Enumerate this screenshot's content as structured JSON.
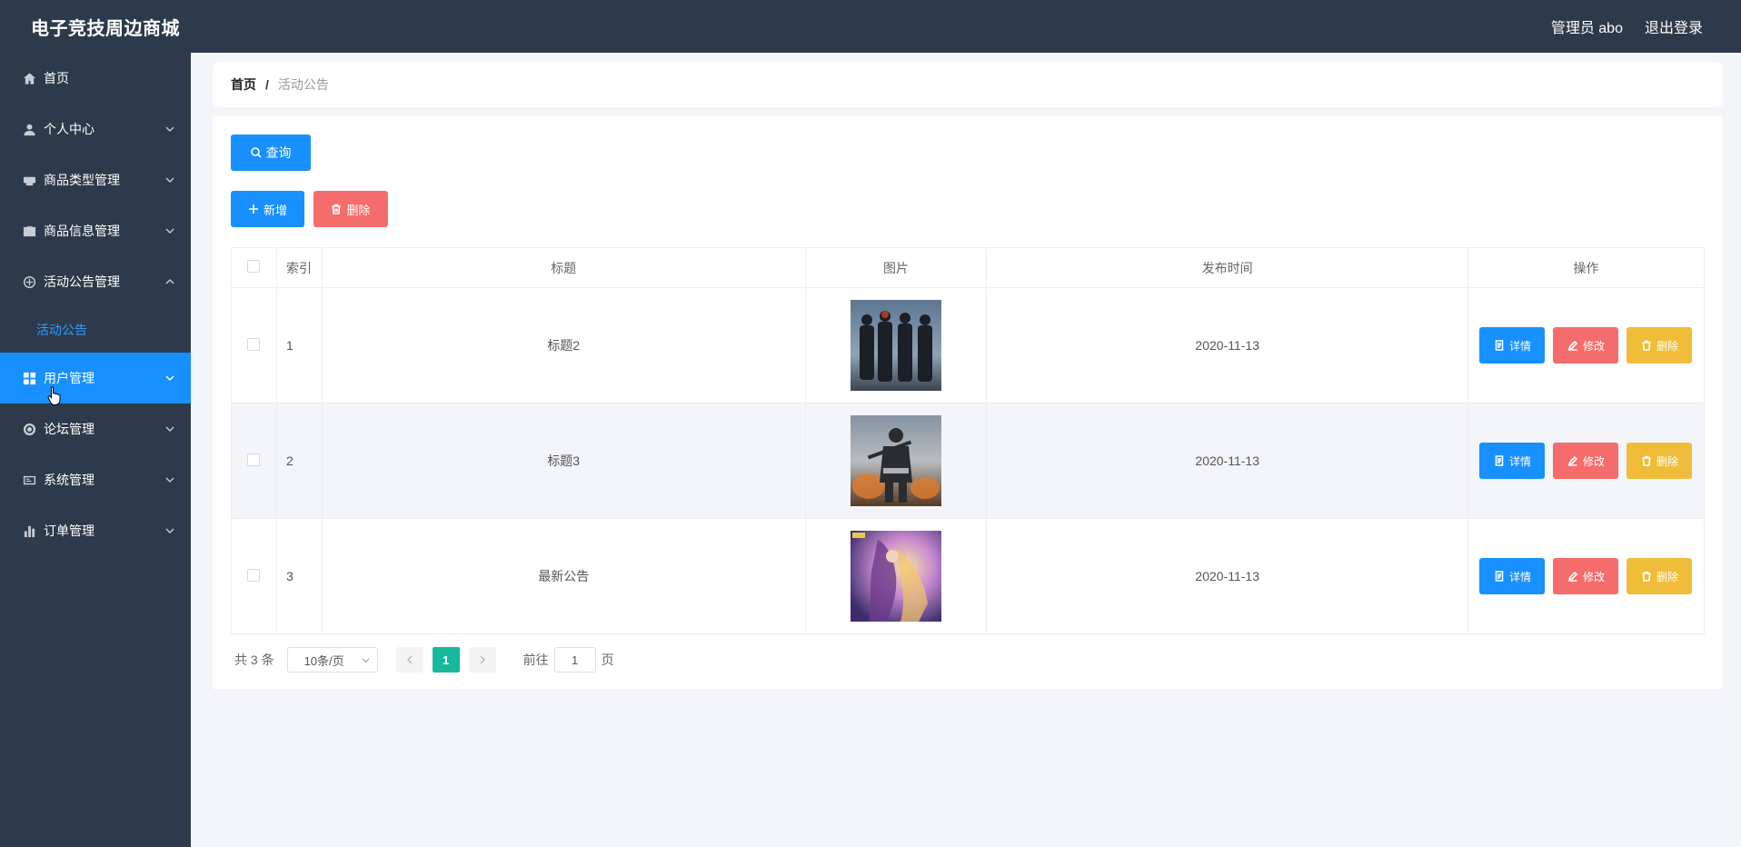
{
  "app": {
    "title": "电子竞技周边商城",
    "user_label": "管理员 abo",
    "logout_label": "退出登录"
  },
  "sidebar": {
    "items": [
      {
        "label": "首页",
        "icon": "home-icon"
      },
      {
        "label": "个人中心",
        "icon": "user-icon"
      },
      {
        "label": "商品类型管理",
        "icon": "printer-icon"
      },
      {
        "label": "商品信息管理",
        "icon": "briefcase-icon"
      },
      {
        "label": "活动公告管理",
        "icon": "compass-icon",
        "expanded": true,
        "children": [
          "活动公告"
        ]
      },
      {
        "label": "用户管理",
        "icon": "grid-icon",
        "active": true
      },
      {
        "label": "论坛管理",
        "icon": "lifebuoy-icon"
      },
      {
        "label": "系统管理",
        "icon": "id-card-icon"
      },
      {
        "label": "订单管理",
        "icon": "bar-chart-icon"
      }
    ]
  },
  "breadcrumb": {
    "home": "首页",
    "separator": "/",
    "current": "活动公告"
  },
  "toolbar": {
    "query_label": "查询",
    "add_label": "新增",
    "delete_label": "删除"
  },
  "table": {
    "columns": [
      "索引",
      "标题",
      "图片",
      "发布时间",
      "操作"
    ],
    "rows": [
      {
        "index": "1",
        "title": "标题2",
        "image": "team-silhouette-image",
        "time": "2020-11-13"
      },
      {
        "index": "2",
        "title": "标题3",
        "image": "pubg-cover-image",
        "time": "2020-11-13"
      },
      {
        "index": "3",
        "title": "最新公告",
        "image": "fantasy-character-image",
        "time": "2020-11-13"
      }
    ],
    "row_actions": {
      "detail_label": "详情",
      "edit_label": "修改",
      "delete_label": "删除"
    }
  },
  "pagination": {
    "total_label": "共 3 条",
    "page_size": "10条/页",
    "current_page": "1",
    "goto_prefix": "前往",
    "goto_value": "1",
    "goto_suffix": "页"
  },
  "colors": {
    "sidebar_bg": "#2d3a4b",
    "primary": "#1890ff",
    "danger": "#f56c6c",
    "warning": "#f0bd3a",
    "pager_active": "#17b89b"
  }
}
